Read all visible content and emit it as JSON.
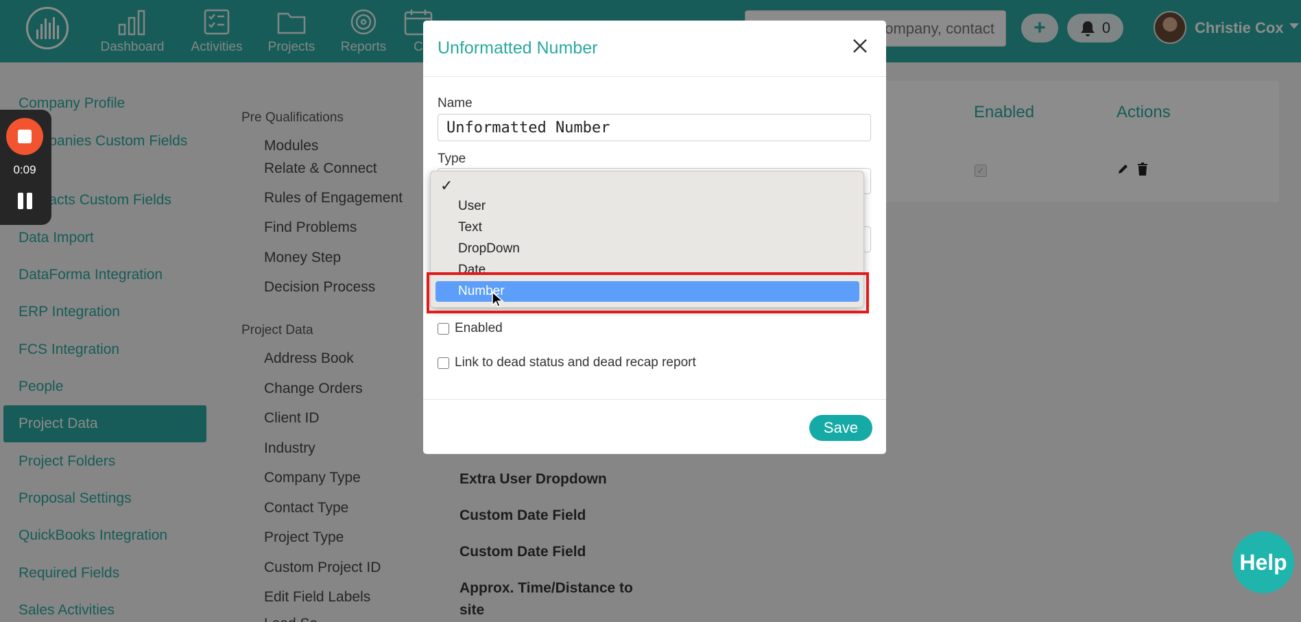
{
  "topbar": {
    "nav": [
      {
        "label": "Dashboard",
        "icon": "bar-chart-icon"
      },
      {
        "label": "Activities",
        "icon": "checklist-icon"
      },
      {
        "label": "Projects",
        "icon": "folder-icon"
      },
      {
        "label": "Reports",
        "icon": "target-icon"
      },
      {
        "label": "C",
        "icon": "calendar-icon"
      }
    ],
    "search_placeholder": "ompany, contact",
    "notifications_count": "0",
    "user_name": "Christie Cox"
  },
  "sidebar": {
    "items": [
      "Company Profile",
      "Companies Custom Fields",
      "Contacts Custom Fields",
      "Data Import",
      "DataForma Integration",
      "ERP Integration",
      "FCS Integration",
      "People",
      "Project Data",
      "Project Folders",
      "Proposal Settings",
      "QuickBooks Integration",
      "Required Fields",
      "Sales Activities"
    ],
    "active": "Project Data"
  },
  "menu": {
    "pre_qualifications": {
      "heading": "Pre Qualifications",
      "items": [
        "Modules",
        "Relate & Connect",
        "Rules of Engagement",
        "Find Problems",
        "Money Step",
        "Decision Process"
      ]
    },
    "project_data": {
      "heading": "Project Data",
      "items": [
        "Address Book",
        "Change Orders",
        "Client ID",
        "Industry",
        "Company Type",
        "Contact Type",
        "Project Type",
        "Custom Project ID",
        "Edit Field Labels",
        "Lead So"
      ]
    }
  },
  "content": {
    "columns": {
      "enabled": "Enabled",
      "actions": "Actions"
    },
    "fields": [
      "Extra User Dropdown",
      "Custom Date Field",
      "Custom Date Field",
      "Approx. Time/Distance to",
      "site"
    ]
  },
  "recorder": {
    "time": "0:09"
  },
  "help": {
    "label": "Help"
  },
  "modal": {
    "title": "Unformatted Number",
    "name_label": "Name",
    "name_value": "Unformatted Number",
    "type_label": "Type",
    "enabled_label": "Enabled",
    "dead_status_label": "Link to dead status and dead recap report",
    "save_label": "Save"
  },
  "dropdown": {
    "check_mark": "✓",
    "options": [
      "User",
      "Text",
      "DropDown",
      "Date",
      "Number"
    ],
    "selected": "Number",
    "selected_color": "#5c9ef9"
  },
  "colors": {
    "brand": "#2aa8a0",
    "highlight": "#e01b1b"
  }
}
